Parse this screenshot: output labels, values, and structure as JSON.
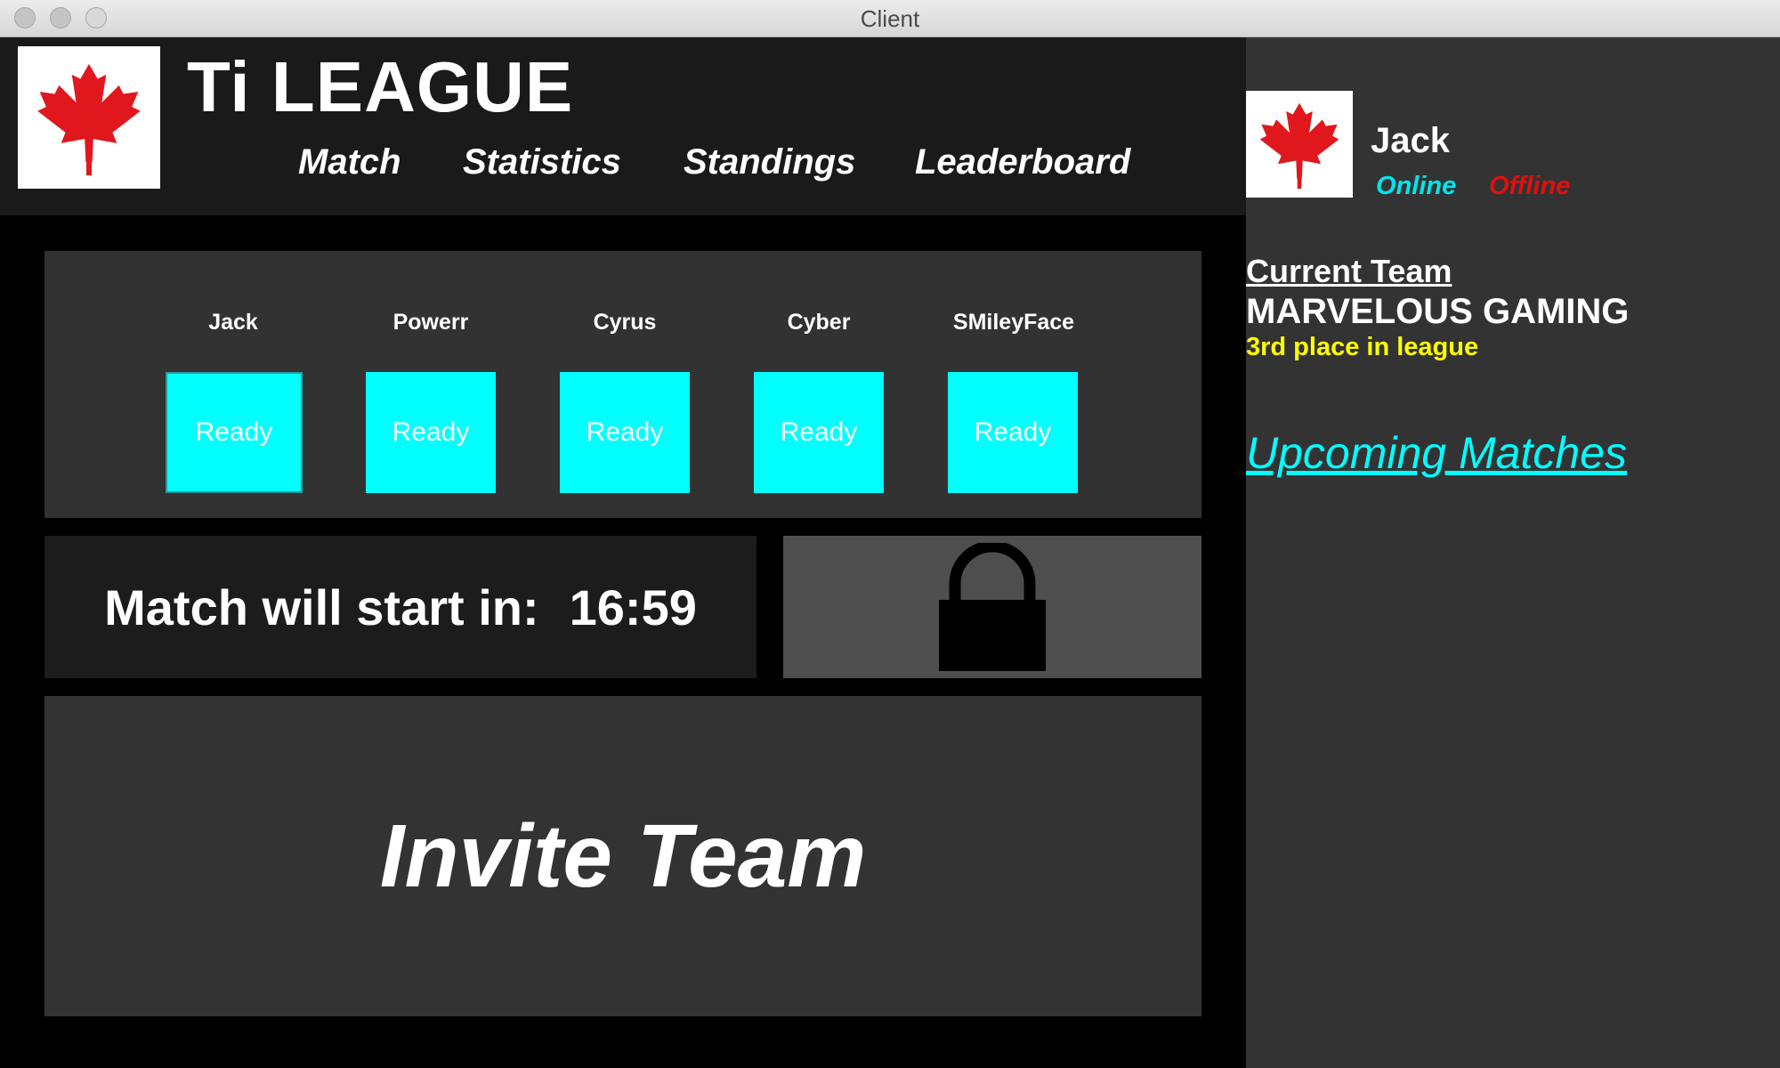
{
  "window": {
    "title": "Client"
  },
  "app": {
    "title": "Ti LEAGUE"
  },
  "nav": [
    "Match",
    "Statistics",
    "Standings",
    "Leaderboard"
  ],
  "players": [
    {
      "name": "Jack",
      "status": "Ready"
    },
    {
      "name": "Powerr",
      "status": "Ready"
    },
    {
      "name": "Cyrus",
      "status": "Ready"
    },
    {
      "name": "Cyber",
      "status": "Ready"
    },
    {
      "name": "SMileyFace",
      "status": "Ready"
    }
  ],
  "match": {
    "countdown_label": "Match will start in:",
    "countdown_value": "16:59"
  },
  "invite": {
    "label": "Invite Team"
  },
  "user": {
    "name": "Jack",
    "online_label": "Online",
    "offline_label": "Offline"
  },
  "team": {
    "heading": "Current Team",
    "name": "MARVELOUS GAMING",
    "place": "3rd place in league"
  },
  "upcoming": {
    "label": "Upcoming Matches"
  },
  "colors": {
    "accent": "#00ffff",
    "online": "#00e5ee",
    "offline": "#e01010",
    "place": "#ffff00"
  },
  "icons": {
    "logo": "canada-flag-icon",
    "lock": "padlock-icon"
  }
}
